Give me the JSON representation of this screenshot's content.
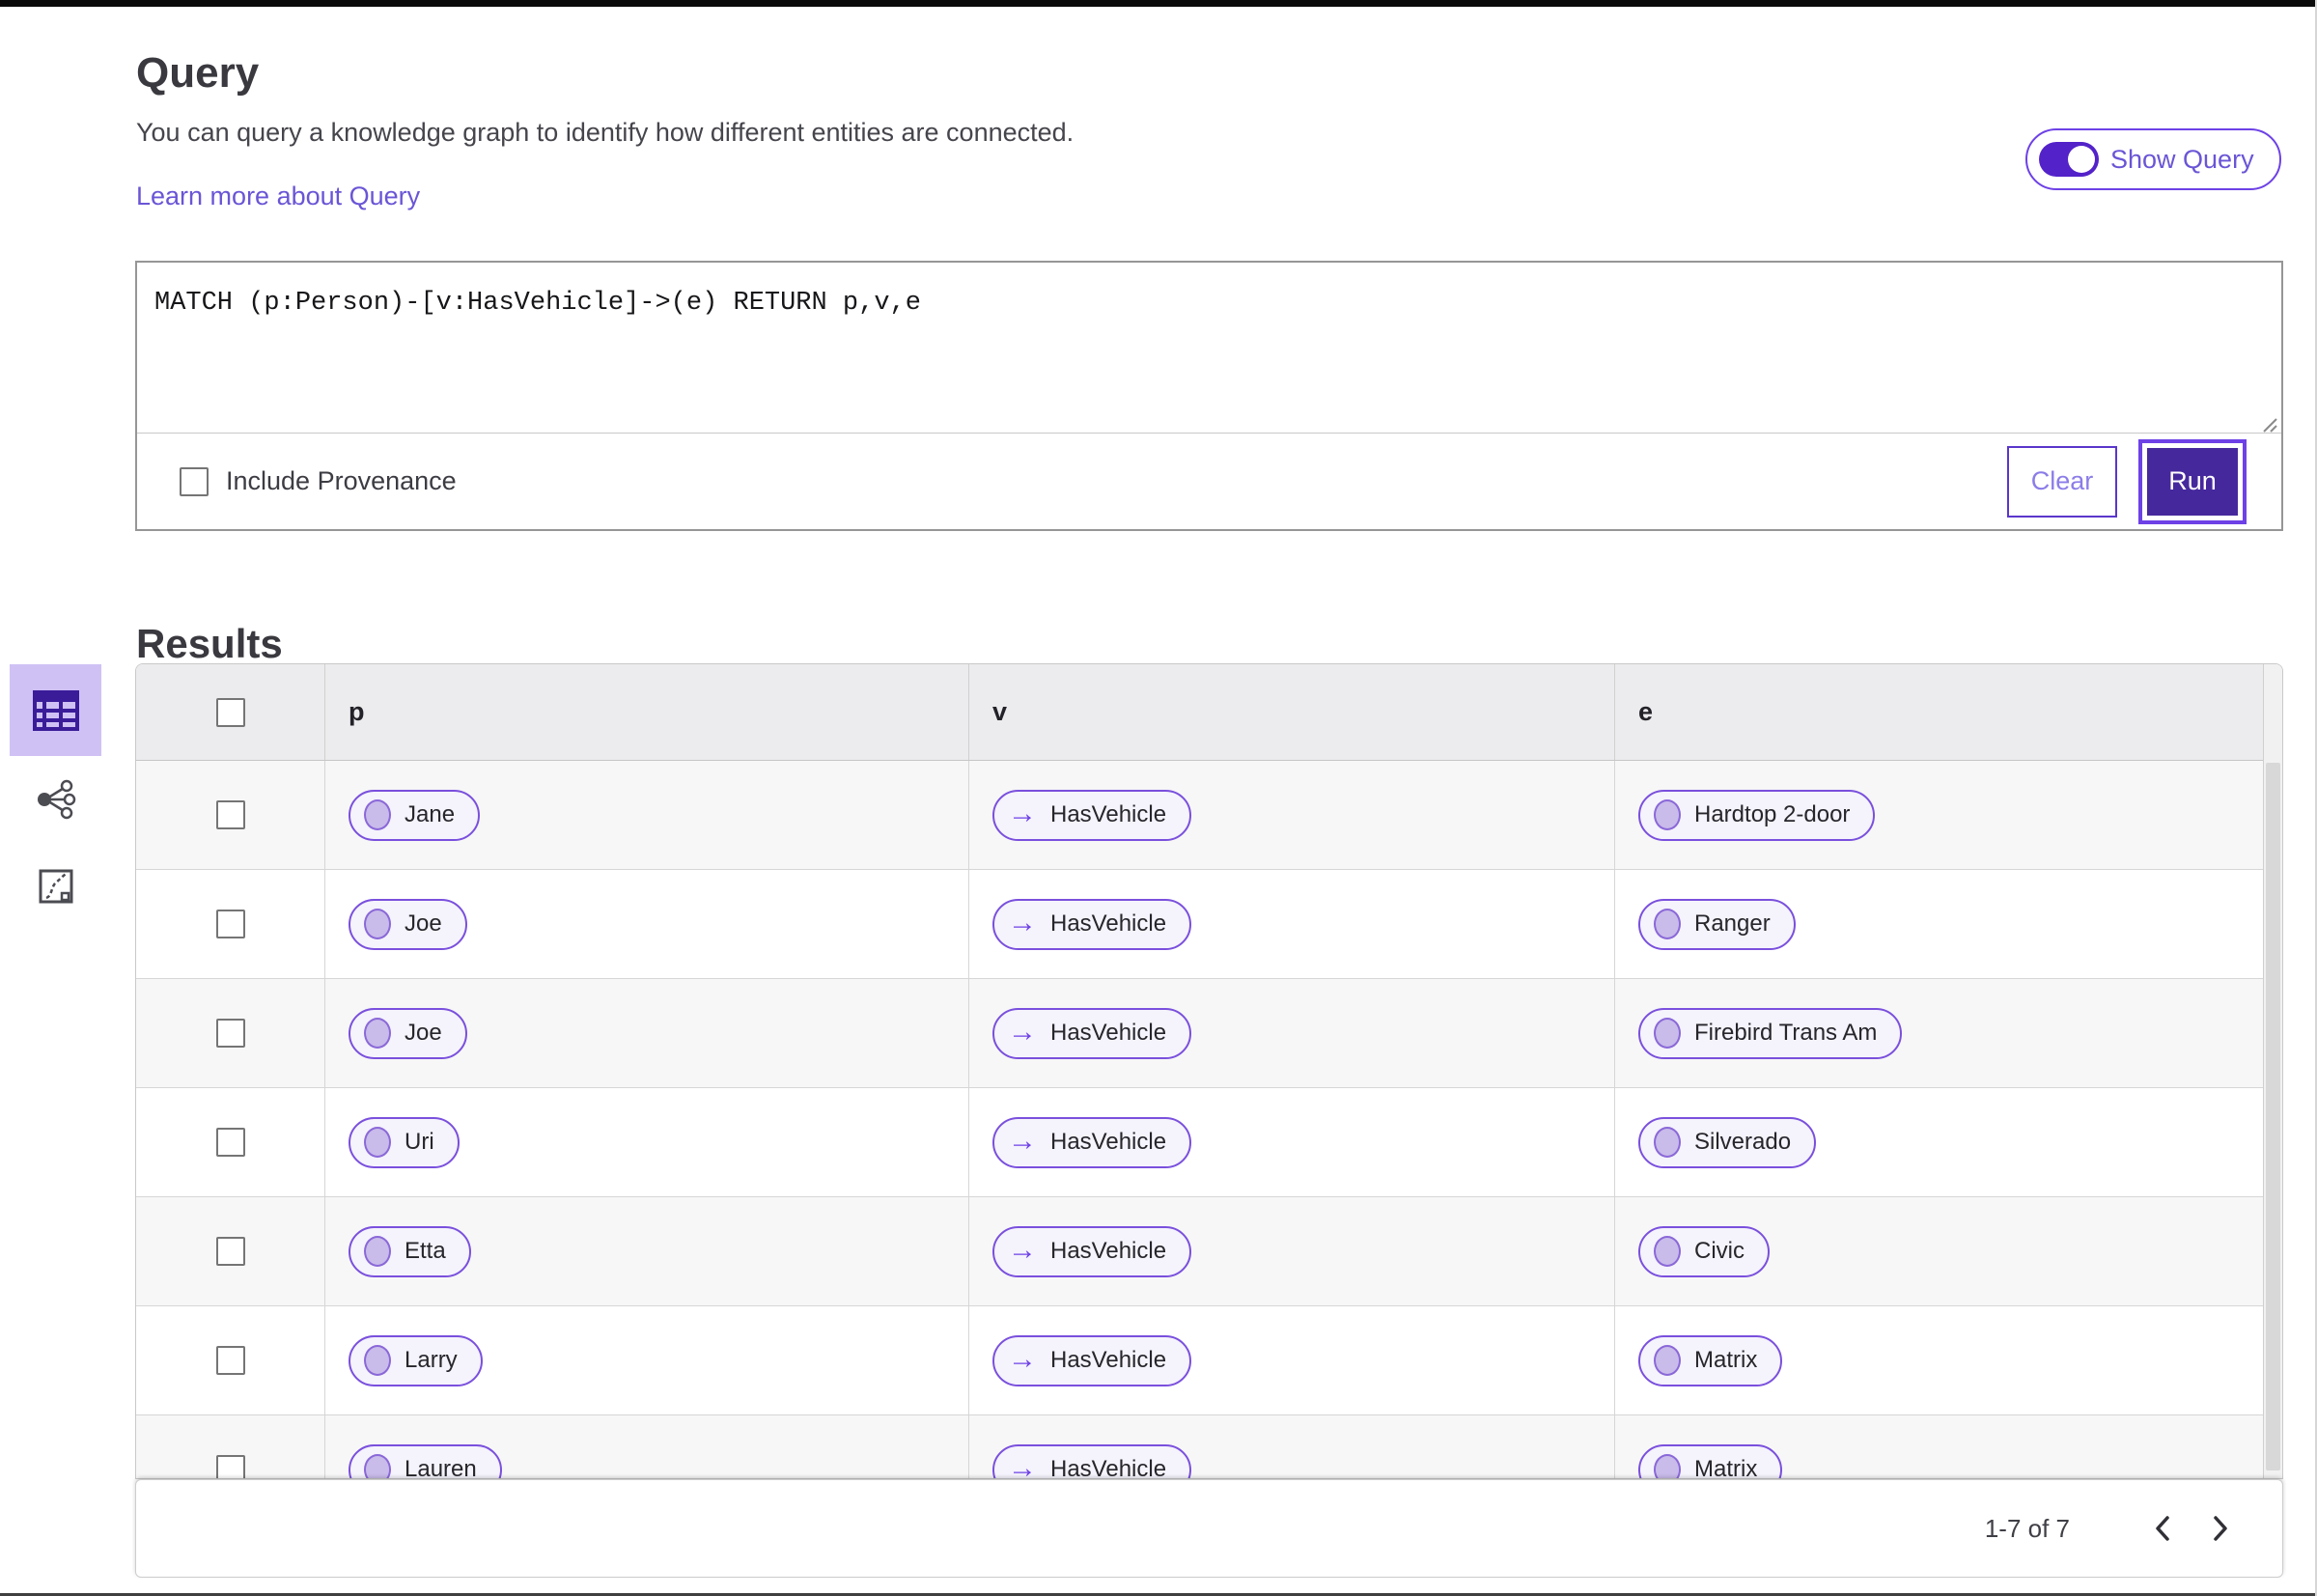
{
  "page": {
    "title": "Query",
    "description": "You can query a knowledge graph to identify how different entities are connected.",
    "learn_more_link": "Learn more about Query"
  },
  "show_query_toggle": {
    "label": "Show Query",
    "state": "on"
  },
  "query_editor": {
    "query_text": "MATCH (p:Person)-[v:HasVehicle]->(e) RETURN p,v,e",
    "include_provenance_label": "Include Provenance",
    "include_provenance_checked": false,
    "clear_label": "Clear",
    "run_label": "Run"
  },
  "results": {
    "title": "Results",
    "view_switcher": {
      "selected": "table-view",
      "items": [
        "table-view",
        "graph-view",
        "chart-view"
      ]
    },
    "columns": [
      "p",
      "v",
      "e"
    ],
    "rows": [
      {
        "p": "Jane",
        "v": "HasVehicle",
        "e": "Hardtop 2-door"
      },
      {
        "p": "Joe",
        "v": "HasVehicle",
        "e": "Ranger"
      },
      {
        "p": "Joe",
        "v": "HasVehicle",
        "e": "Firebird Trans Am"
      },
      {
        "p": "Uri",
        "v": "HasVehicle",
        "e": "Silverado"
      },
      {
        "p": "Etta",
        "v": "HasVehicle",
        "e": "Civic"
      },
      {
        "p": "Larry",
        "v": "HasVehicle",
        "e": "Matrix"
      },
      {
        "p": "Lauren",
        "v": "HasVehicle",
        "e": "Matrix"
      }
    ],
    "pagination": {
      "range_label": "1-7 of 7"
    }
  },
  "icons": {
    "edge_arrow": "→"
  },
  "colors": {
    "accent_dark": "#46289d",
    "accent_bright": "#6d41e6",
    "toggle_track": "#5322c9",
    "pill_border": "#7a50dd",
    "pill_bg": "#f5f3fc",
    "node_fill": "#c9bbea",
    "link": "#6a55d6",
    "row_alt": "#f7f7f7",
    "header_bg": "#ececee",
    "selected_view_bg": "#cfc1f4"
  }
}
